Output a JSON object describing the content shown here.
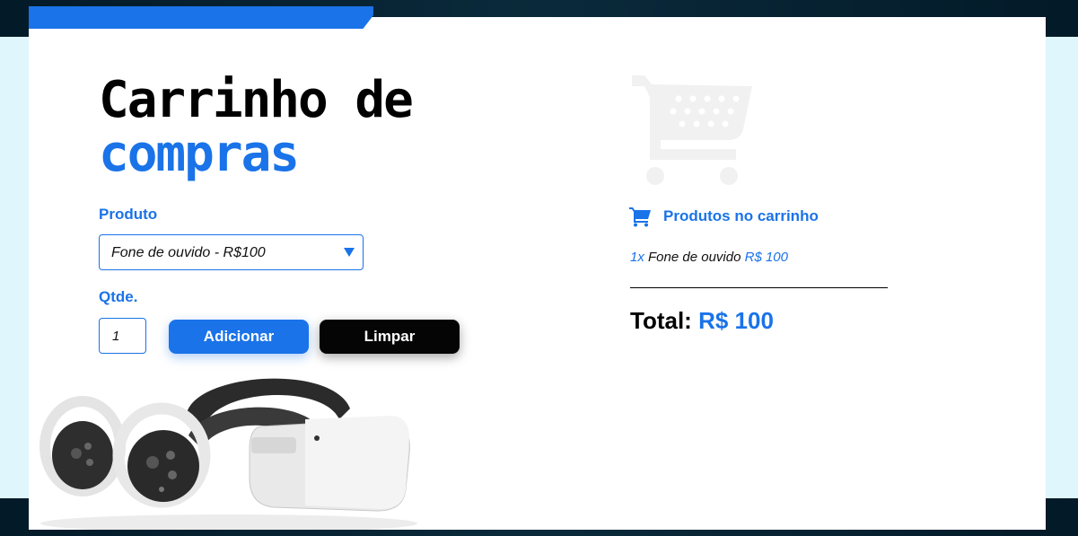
{
  "title": {
    "line1": "Carrinho de",
    "line2": "compras"
  },
  "form": {
    "product_label": "Produto",
    "product_selected": "Fone de ouvido - R$100",
    "qty_label": "Qtde.",
    "qty_value": "1",
    "add_button": "Adicionar",
    "clear_button": "Limpar"
  },
  "cart": {
    "heading": "Produtos no carrinho",
    "items": [
      {
        "qty": "1x",
        "name": "Fone de ouvido",
        "price": "R$ 100"
      }
    ],
    "total_label": "Total:",
    "total_value": "R$ 100"
  },
  "icons": {
    "cart_large": "shopping-cart-icon",
    "cart_small": "shopping-cart-icon",
    "select_arrow": "caret-down-icon"
  },
  "colors": {
    "accent": "#1a73e8",
    "dark": "#050505",
    "background": "#dff6fd"
  }
}
